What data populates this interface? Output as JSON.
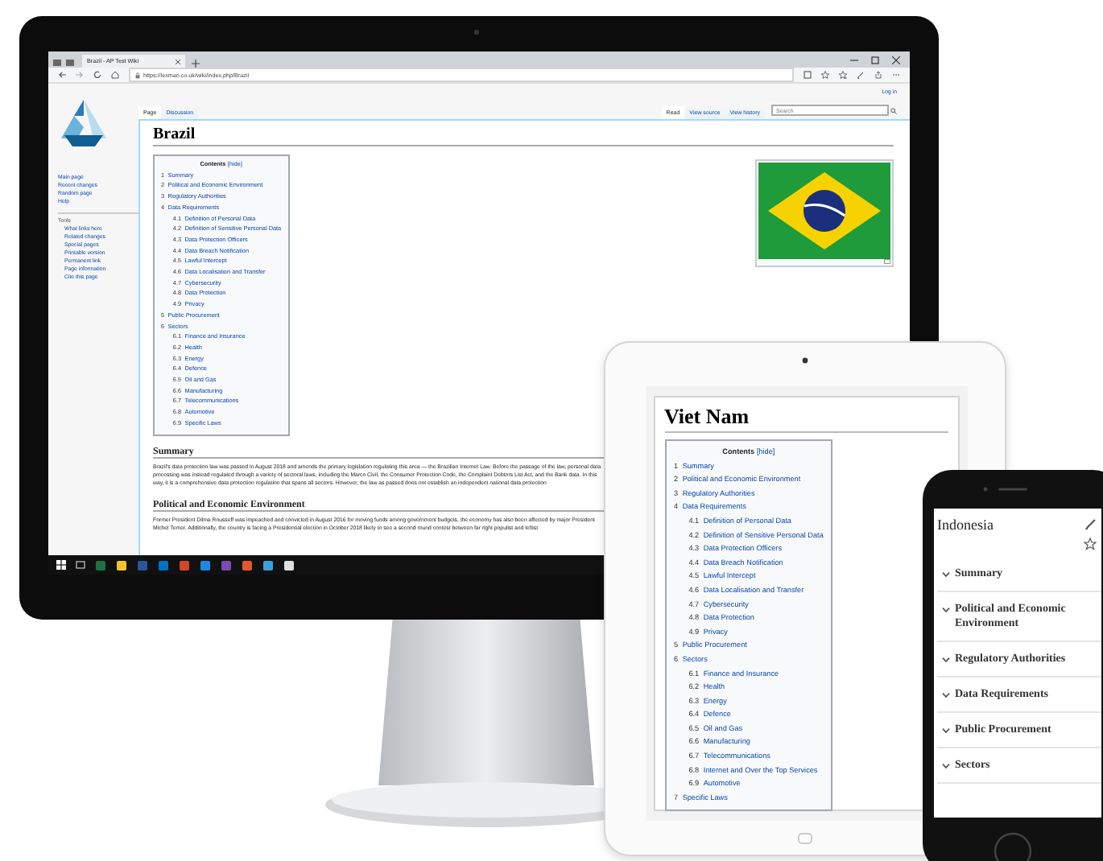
{
  "monitor": {
    "browser": {
      "tab_title": "Brazil - AP Test Wiki",
      "url": "https://lexman.co.uk/wiki/index.php/Brazil"
    },
    "wiki": {
      "log_in": "Log in",
      "sidebar": {
        "nav": [
          "Main page",
          "Recent changes",
          "Random page",
          "Help"
        ],
        "tools_heading": "Tools",
        "tools": [
          "What links here",
          "Related changes",
          "Special pages",
          "Printable version",
          "Permanent link",
          "Page information",
          "Cite this page"
        ]
      },
      "page_tabs": [
        {
          "label": "Page",
          "selected": true
        },
        {
          "label": "Discussion",
          "selected": false
        }
      ],
      "view_tabs": [
        {
          "label": "Read",
          "selected": true
        },
        {
          "label": "View source",
          "selected": false
        },
        {
          "label": "View history",
          "selected": false
        }
      ],
      "search": {
        "placeholder": "Search"
      },
      "title": "Brazil",
      "toc": {
        "heading": "Contents",
        "toggle": "[hide]",
        "items": [
          {
            "number": "1",
            "title": "Summary"
          },
          {
            "number": "2",
            "title": "Political and Economic Environment"
          },
          {
            "number": "3",
            "title": "Regulatory Authorities"
          },
          {
            "number": "4",
            "title": "Data Requirements",
            "children": [
              {
                "number": "4.1",
                "title": "Definition of Personal Data"
              },
              {
                "number": "4.2",
                "title": "Definition of Sensitive Personal Data"
              },
              {
                "number": "4.3",
                "title": "Data Protection Officers"
              },
              {
                "number": "4.4",
                "title": "Data Breach Notification"
              },
              {
                "number": "4.5",
                "title": "Lawful Intercept"
              },
              {
                "number": "4.6",
                "title": "Data Localisation and Transfer"
              },
              {
                "number": "4.7",
                "title": "Cybersecurity"
              },
              {
                "number": "4.8",
                "title": "Data Protection"
              },
              {
                "number": "4.9",
                "title": "Privacy"
              }
            ]
          },
          {
            "number": "5",
            "title": "Public Procurement"
          },
          {
            "number": "6",
            "title": "Sectors",
            "children": [
              {
                "number": "6.1",
                "title": "Finance and Insurance"
              },
              {
                "number": "6.2",
                "title": "Health"
              },
              {
                "number": "6.3",
                "title": "Energy"
              },
              {
                "number": "6.4",
                "title": "Defence"
              },
              {
                "number": "6.5",
                "title": "Oil and Gas"
              },
              {
                "number": "6.6",
                "title": "Manufacturing"
              },
              {
                "number": "6.7",
                "title": "Telecommunications"
              },
              {
                "number": "6.8",
                "title": "Automotive"
              },
              {
                "number": "6.9",
                "title": "Specific Laws"
              }
            ]
          }
        ]
      },
      "sections": [
        {
          "heading": "Summary",
          "text": "Brazil's data protection law was passed in August 2018 and amends the primary legislation regulating this area — the Brazilian Internet Law. Before the passage of the law, personal data processing was instead regulated through a variety of sectoral laws, including the Marco Civil, the Consumer Protection Code, the Complaint Debtors List Act, and the Bank data. In this way, it is a comprehensive data protection regulation that spans all sectors. However, the law as passed does not establish an independent national data protection"
        },
        {
          "heading": "Political and Economic Environment",
          "text": "Former President Dilma Rousseff was impeached and convicted in August 2016 for moving funds among government budgets, the economy has also been affected by major President Michel Temer. Additionally, the country is facing a Presidential election in October 2018 likely to see a second round contest between far right populist and leftist"
        }
      ]
    }
  },
  "tablet": {
    "title": "Viet Nam",
    "toc": {
      "heading": "Contents",
      "toggle": "[hide]",
      "items": [
        {
          "number": "1",
          "title": "Summary"
        },
        {
          "number": "2",
          "title": "Political and Economic Environment"
        },
        {
          "number": "3",
          "title": "Regulatory Authorities"
        },
        {
          "number": "4",
          "title": "Data Requirements",
          "children": [
            {
              "number": "4.1",
              "title": "Definition of Personal Data"
            },
            {
              "number": "4.2",
              "title": "Definition of Sensitive Personal Data"
            },
            {
              "number": "4.3",
              "title": "Data Protection Officers"
            },
            {
              "number": "4.4",
              "title": "Data Breach Notification"
            },
            {
              "number": "4.5",
              "title": "Lawful Intercept"
            },
            {
              "number": "4.6",
              "title": "Data Localisation and Transfer"
            },
            {
              "number": "4.7",
              "title": "Cybersecurity"
            },
            {
              "number": "4.8",
              "title": "Data Protection"
            },
            {
              "number": "4.9",
              "title": "Privacy"
            }
          ]
        },
        {
          "number": "5",
          "title": "Public Procurement"
        },
        {
          "number": "6",
          "title": "Sectors",
          "children": [
            {
              "number": "6.1",
              "title": "Finance and Insurance"
            },
            {
              "number": "6.2",
              "title": "Health"
            },
            {
              "number": "6.3",
              "title": "Energy"
            },
            {
              "number": "6.4",
              "title": "Defence"
            },
            {
              "number": "6.5",
              "title": "Oil and Gas"
            },
            {
              "number": "6.6",
              "title": "Manufacturing"
            },
            {
              "number": "6.7",
              "title": "Telecommunications"
            },
            {
              "number": "6.8",
              "title": "Internet and Over the Top Services"
            },
            {
              "number": "6.9",
              "title": "Automotive"
            }
          ]
        },
        {
          "number": "7",
          "title": "Specific Laws"
        }
      ]
    }
  },
  "phone": {
    "title": "Indonesia",
    "sections": [
      "Summary",
      "Political and Economic Environment",
      "Regulatory Authorities",
      "Data Requirements",
      "Public Procurement",
      "Sectors"
    ]
  }
}
